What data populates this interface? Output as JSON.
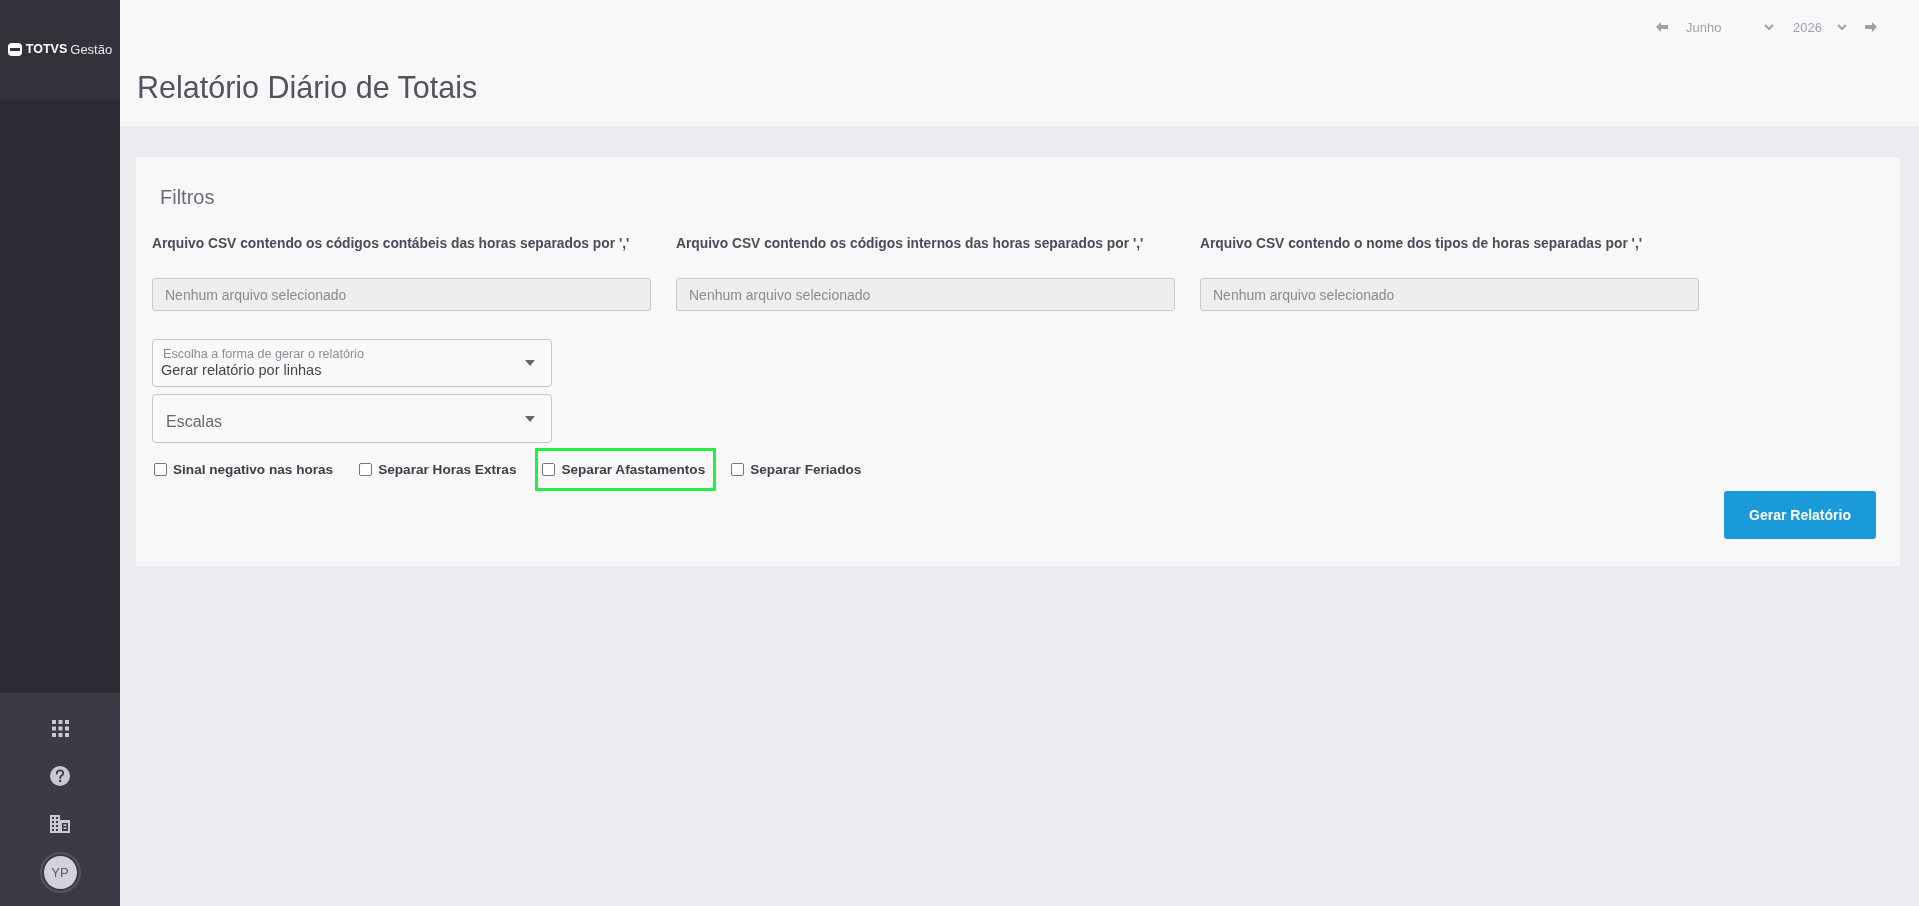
{
  "sidebar": {
    "logo": {
      "brand": "TOTVS",
      "product": "Gestão"
    },
    "avatar": {
      "initials": "YP"
    }
  },
  "header": {
    "title": "Relatório Diário de Totais",
    "period": {
      "month": "Junho",
      "year": "2026"
    }
  },
  "filters": {
    "title": "Filtros",
    "file_inputs": [
      {
        "label": "Arquivo CSV contendo os códigos contábeis das horas separados por ','",
        "placeholder": "Nenhum arquivo selecionado"
      },
      {
        "label": "Arquivo CSV contendo os códigos internos das horas separados por ','",
        "placeholder": "Nenhum arquivo selecionado"
      },
      {
        "label": "Arquivo CSV contendo o nome dos tipos de horas separadas por ','",
        "placeholder": "Nenhum arquivo selecionado"
      }
    ],
    "selects": [
      {
        "label": "Escolha a forma de gerar o relatório",
        "value": "Gerar relatório por linhas"
      },
      {
        "placeholder": "Escalas"
      }
    ],
    "checkboxes": [
      {
        "label": "Sinal negativo nas horas",
        "checked": false,
        "highlighted": false
      },
      {
        "label": "Separar Horas Extras",
        "checked": false,
        "highlighted": false
      },
      {
        "label": "Separar Afastamentos",
        "checked": false,
        "highlighted": true
      },
      {
        "label": "Separar Feriados",
        "checked": false,
        "highlighted": false
      }
    ],
    "submit_button": "Gerar Relatório"
  }
}
